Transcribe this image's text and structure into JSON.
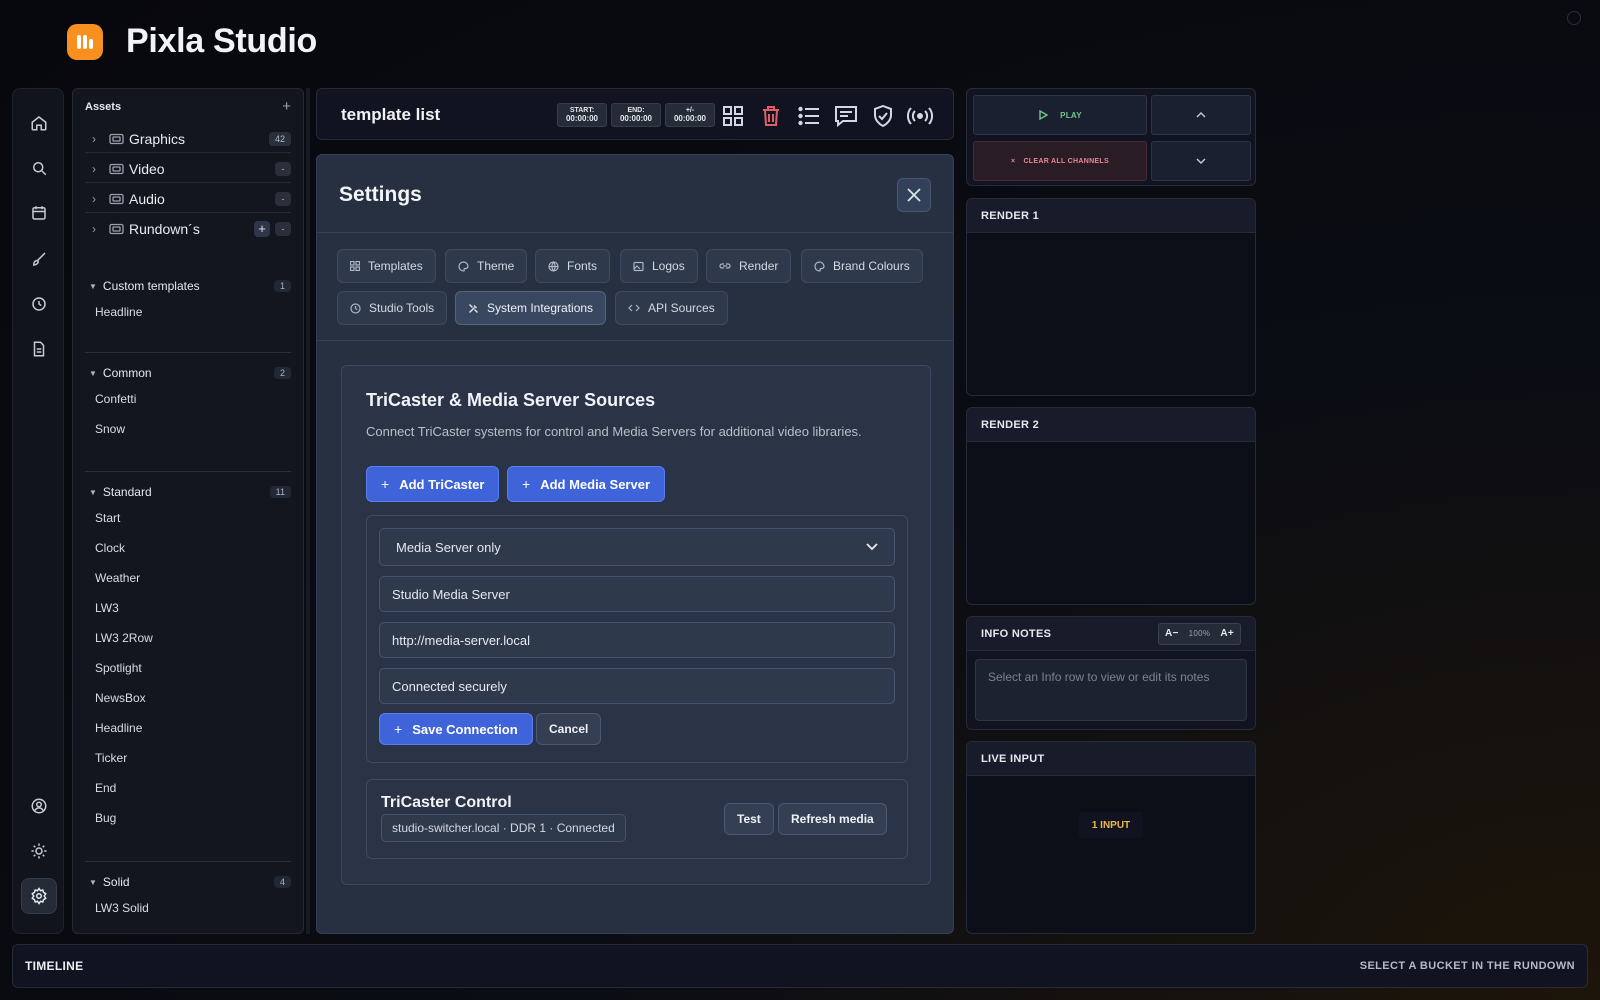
{
  "app": {
    "title": "Pixla Studio"
  },
  "assets": {
    "title": "Assets",
    "folders": [
      {
        "label": "Graphics",
        "count": "42"
      },
      {
        "label": "Video",
        "count": "-"
      },
      {
        "label": "Audio",
        "count": "-"
      },
      {
        "label": "Rundown´s",
        "count": "-",
        "add": "+"
      }
    ],
    "groups": [
      {
        "label": "Custom templates",
        "count": "1",
        "items": [
          "Headline"
        ]
      },
      {
        "label": "Common",
        "count": "2",
        "items": [
          "Confetti",
          "Snow"
        ]
      },
      {
        "label": "Standard",
        "count": "11",
        "items": [
          "Start",
          "Clock",
          "Weather",
          "LW3",
          "LW3 2Row",
          "Spotlight",
          "NewsBox",
          "Headline",
          "Ticker",
          "End",
          "Bug"
        ]
      },
      {
        "label": "Solid",
        "count": "4",
        "items": [
          "LW3 Solid"
        ]
      }
    ]
  },
  "toolbar": {
    "title": "template list",
    "start": {
      "label": "START:",
      "value": "00:00:00"
    },
    "end": {
      "label": "END:",
      "value": "00:00:00"
    },
    "delta": {
      "label": "+/-",
      "value": "00:00:00"
    }
  },
  "settings": {
    "title": "Settings",
    "tabs": [
      "Templates",
      "Theme",
      "Fonts",
      "Logos",
      "Render",
      "Brand Colours",
      "Studio Tools",
      "System Integrations",
      "API Sources"
    ],
    "active_tab": "System Integrations",
    "section": {
      "title": "TriCaster & Media Server Sources",
      "description": "Connect TriCaster systems for control and Media Servers for additional video libraries.",
      "add_tricaster": "Add TriCaster",
      "add_media_server": "Add Media Server",
      "form": {
        "type_selected": "Media Server only",
        "name_value": "Studio Media Server",
        "url_value": "http://media-server.local",
        "status_value": "Connected securely",
        "save_label": "Save Connection",
        "cancel_label": "Cancel"
      },
      "tricaster": {
        "title": "TriCaster Control",
        "meta": "studio-switcher.local · DDR 1 · Connected",
        "test_label": "Test",
        "refresh_label": "Refresh media"
      }
    }
  },
  "playout": {
    "play_label": "PLAY",
    "clear_label": "CLEAR ALL CHANNELS"
  },
  "render1": {
    "title": "RENDER 1"
  },
  "render2": {
    "title": "RENDER 2"
  },
  "info_notes": {
    "title": "INFO NOTES",
    "zoom_out": "A−",
    "zoom_level": "100%",
    "zoom_in": "A+",
    "placeholder": "Select an Info row to view or edit its notes"
  },
  "live_input": {
    "title": "LIVE INPUT",
    "badge": "1 INPUT"
  },
  "timeline": {
    "title": "TIMELINE",
    "hint": "SELECT A BUCKET IN THE RUNDOWN"
  },
  "colors": {
    "accent": "#3f63d9",
    "brand": "#f7901e",
    "play": "#6fc98a",
    "danger": "#e98795",
    "warning": "#f0b94a"
  }
}
